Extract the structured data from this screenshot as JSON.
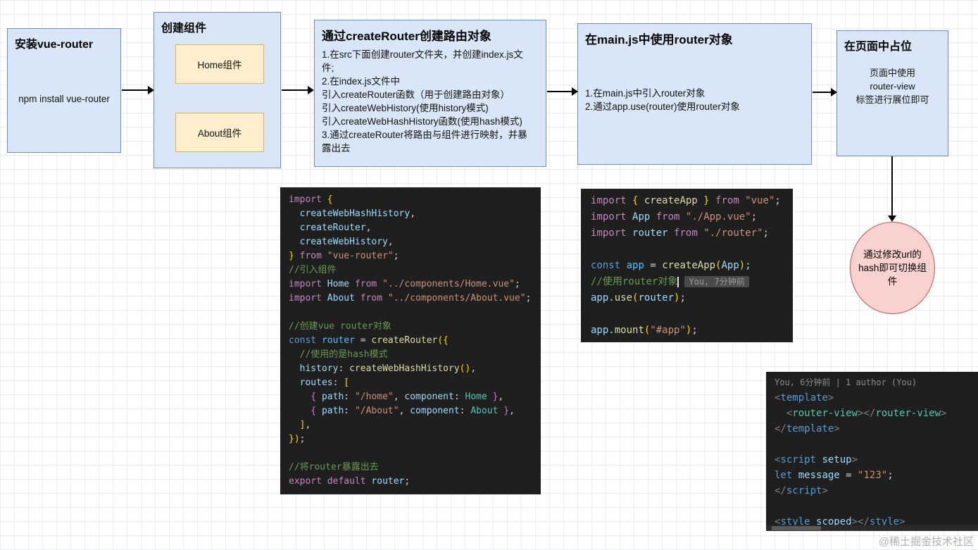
{
  "flow": {
    "box1": {
      "title": "安装vue-router",
      "body": "npm install vue-router"
    },
    "box2": {
      "title": "创建组件",
      "items": [
        {
          "label": "Home组件"
        },
        {
          "label": "About组件"
        }
      ]
    },
    "box3": {
      "title": "通过createRouter创建路由对象",
      "body": "1.在src下面创建router文件夹，并创建index.js文\n件;\n2.在index.js文件中\n引入createRouter函数（用于创建路由对象）\n引入createWebHistory(使用history模式)\n引入createWebHashHistory函数(使用hash模式)\n3.通过createRouter将路由与组件进行映射，并暴\n露出去"
    },
    "box4": {
      "title": "在main.js中使用router对象",
      "body": "1.在main.js中引入router对象\n2.通过app.use(router)使用router对象"
    },
    "box5": {
      "title": "在页面中占位",
      "body": "页面中使用\nrouter-view\n标签进行展位即可"
    },
    "bubble": {
      "text": "通过修改url的\nhash即可切换组\n件"
    }
  },
  "code_blocks": {
    "router_index": {
      "lines": [
        [
          [
            "kw",
            "import"
          ],
          [
            "pun",
            " "
          ],
          [
            "brk",
            "{"
          ]
        ],
        [
          [
            "var",
            "  createWebHashHistory"
          ],
          [
            "pun",
            ","
          ]
        ],
        [
          [
            "var",
            "  createRouter"
          ],
          [
            "pun",
            ","
          ]
        ],
        [
          [
            "var",
            "  createWebHistory"
          ],
          [
            "pun",
            ","
          ]
        ],
        [
          [
            "brk",
            "}"
          ],
          [
            "pun",
            " "
          ],
          [
            "kw",
            "from"
          ],
          [
            "pun",
            " "
          ],
          [
            "str",
            "\"vue-router\""
          ],
          [
            "pun",
            ";"
          ]
        ],
        [
          [
            "com",
            "//引入组件"
          ]
        ],
        [
          [
            "kw",
            "import"
          ],
          [
            "pun",
            " "
          ],
          [
            "var",
            "Home"
          ],
          [
            "pun",
            " "
          ],
          [
            "kw",
            "from"
          ],
          [
            "pun",
            " "
          ],
          [
            "str",
            "\"../components/Home.vue\""
          ],
          [
            "pun",
            ";"
          ]
        ],
        [
          [
            "kw",
            "import"
          ],
          [
            "pun",
            " "
          ],
          [
            "var",
            "About"
          ],
          [
            "pun",
            " "
          ],
          [
            "kw",
            "from"
          ],
          [
            "pun",
            " "
          ],
          [
            "str",
            "\"../components/About.vue\""
          ],
          [
            "pun",
            ";"
          ]
        ],
        [],
        [
          [
            "com",
            "//创建vue router对象"
          ]
        ],
        [
          [
            "decl",
            "const"
          ],
          [
            "pun",
            " "
          ],
          [
            "varc",
            "router"
          ],
          [
            "pun",
            " = "
          ],
          [
            "fn",
            "createRouter"
          ],
          [
            "brk",
            "({"
          ]
        ],
        [
          [
            "com",
            "  //使用的是hash模式"
          ]
        ],
        [
          [
            "var",
            "  history"
          ],
          [
            "pun",
            ": "
          ],
          [
            "fn",
            "createWebHashHistory"
          ],
          [
            "brk",
            "()"
          ],
          [
            "pun",
            ","
          ]
        ],
        [
          [
            "var",
            "  routes"
          ],
          [
            "pun",
            ": "
          ],
          [
            "brk",
            "["
          ]
        ],
        [
          [
            "brkp",
            "    { "
          ],
          [
            "var",
            "path"
          ],
          [
            "pun",
            ": "
          ],
          [
            "str",
            "\"/home\""
          ],
          [
            "pun",
            ", "
          ],
          [
            "var",
            "component"
          ],
          [
            "pun",
            ": "
          ],
          [
            "teal",
            "Home"
          ],
          [
            "brkp",
            " }"
          ],
          [
            "pun",
            ","
          ]
        ],
        [
          [
            "brkp",
            "    { "
          ],
          [
            "var",
            "path"
          ],
          [
            "pun",
            ": "
          ],
          [
            "str",
            "\"/About\""
          ],
          [
            "pun",
            ", "
          ],
          [
            "var",
            "component"
          ],
          [
            "pun",
            ": "
          ],
          [
            "teal",
            "About"
          ],
          [
            "brkp",
            " }"
          ],
          [
            "pun",
            ","
          ]
        ],
        [
          [
            "brk",
            "  ]"
          ],
          [
            "pun",
            ","
          ]
        ],
        [
          [
            "brk",
            "})"
          ],
          [
            "pun",
            ";"
          ]
        ],
        [],
        [
          [
            "com",
            "//将router暴露出去"
          ]
        ],
        [
          [
            "kw",
            "export"
          ],
          [
            "pun",
            " "
          ],
          [
            "kw",
            "default"
          ],
          [
            "pun",
            " "
          ],
          [
            "var",
            "router"
          ],
          [
            "pun",
            ";"
          ]
        ]
      ]
    },
    "main_js": {
      "lines": [
        [
          [
            "kw",
            "import"
          ],
          [
            "pun",
            " "
          ],
          [
            "brk",
            "{"
          ],
          [
            "fn",
            " createApp "
          ],
          [
            "brk",
            "}"
          ],
          [
            "pun",
            " "
          ],
          [
            "kw",
            "from"
          ],
          [
            "pun",
            " "
          ],
          [
            "str",
            "\"vue\""
          ],
          [
            "pun",
            ";"
          ]
        ],
        [
          [
            "kw",
            "import"
          ],
          [
            "pun",
            " "
          ],
          [
            "var",
            "App"
          ],
          [
            "pun",
            " "
          ],
          [
            "kw",
            "from"
          ],
          [
            "pun",
            " "
          ],
          [
            "str",
            "\"./App.vue\""
          ],
          [
            "pun",
            ";"
          ]
        ],
        [
          [
            "kw",
            "import"
          ],
          [
            "pun",
            " "
          ],
          [
            "var",
            "router"
          ],
          [
            "pun",
            " "
          ],
          [
            "kw",
            "from"
          ],
          [
            "pun",
            " "
          ],
          [
            "str",
            "\"./router\""
          ],
          [
            "pun",
            ";"
          ]
        ],
        [],
        [
          [
            "decl",
            "const"
          ],
          [
            "pun",
            " "
          ],
          [
            "varc",
            "app"
          ],
          [
            "pun",
            " = "
          ],
          [
            "fn",
            "createApp"
          ],
          [
            "brk",
            "("
          ],
          [
            "var",
            "App"
          ],
          [
            "brk",
            ")"
          ],
          [
            "pun",
            ";"
          ]
        ],
        [
          [
            "com",
            "//使用router对象"
          ],
          [
            "cursor",
            ""
          ],
          [
            "blame",
            "You, 7分钟前"
          ]
        ],
        [
          [
            "var",
            "app"
          ],
          [
            "pun",
            "."
          ],
          [
            "fn",
            "use"
          ],
          [
            "brk",
            "("
          ],
          [
            "var",
            "router"
          ],
          [
            "brk",
            ")"
          ],
          [
            "pun",
            ";"
          ]
        ],
        [],
        [
          [
            "var",
            "app"
          ],
          [
            "pun",
            "."
          ],
          [
            "fn",
            "mount"
          ],
          [
            "brk",
            "("
          ],
          [
            "str",
            "\"#app\""
          ],
          [
            "brk",
            ")"
          ],
          [
            "pun",
            ";"
          ]
        ]
      ]
    },
    "app_vue": {
      "lines": [
        [
          [
            "dim",
            "You, 6分钟前 | 1 author (You)"
          ]
        ],
        [
          [
            "tagb",
            "<"
          ],
          [
            "tag",
            "template"
          ],
          [
            "tagb",
            ">"
          ]
        ],
        [
          [
            "tagb",
            "  <"
          ],
          [
            "teal",
            "router-view"
          ],
          [
            "tagb",
            "></"
          ],
          [
            "teal",
            "router-view"
          ],
          [
            "tagb",
            ">"
          ]
        ],
        [
          [
            "tagb",
            "</"
          ],
          [
            "tag",
            "template"
          ],
          [
            "tagb",
            ">"
          ]
        ],
        [],
        [
          [
            "tagb",
            "<"
          ],
          [
            "tag",
            "script"
          ],
          [
            "var",
            " setup"
          ],
          [
            "tagb",
            ">"
          ]
        ],
        [
          [
            "decl",
            "let"
          ],
          [
            "pun",
            " "
          ],
          [
            "var",
            "message"
          ],
          [
            "pun",
            " = "
          ],
          [
            "str",
            "\"123\""
          ],
          [
            "pun",
            ";"
          ]
        ],
        [
          [
            "tagb",
            "</"
          ],
          [
            "tag",
            "script"
          ],
          [
            "tagb",
            ">"
          ]
        ],
        [],
        [
          [
            "tagb",
            "<"
          ],
          [
            "tag",
            "style"
          ],
          [
            "var",
            " scoped"
          ],
          [
            "tagb",
            "></"
          ],
          [
            "tag",
            "style"
          ],
          [
            "tagb",
            ">"
          ]
        ]
      ]
    }
  },
  "colors": {
    "flow_box_fill": "#d9e6f8",
    "flow_box_border": "#6c8ebf",
    "component_fill": "#ffeecb",
    "component_border": "#d9b55a",
    "bubble_fill": "#f9d2d0",
    "bubble_border": "#b85450",
    "code_background": "#1f1f1f"
  },
  "watermark": "@稀土掘金技术社区"
}
